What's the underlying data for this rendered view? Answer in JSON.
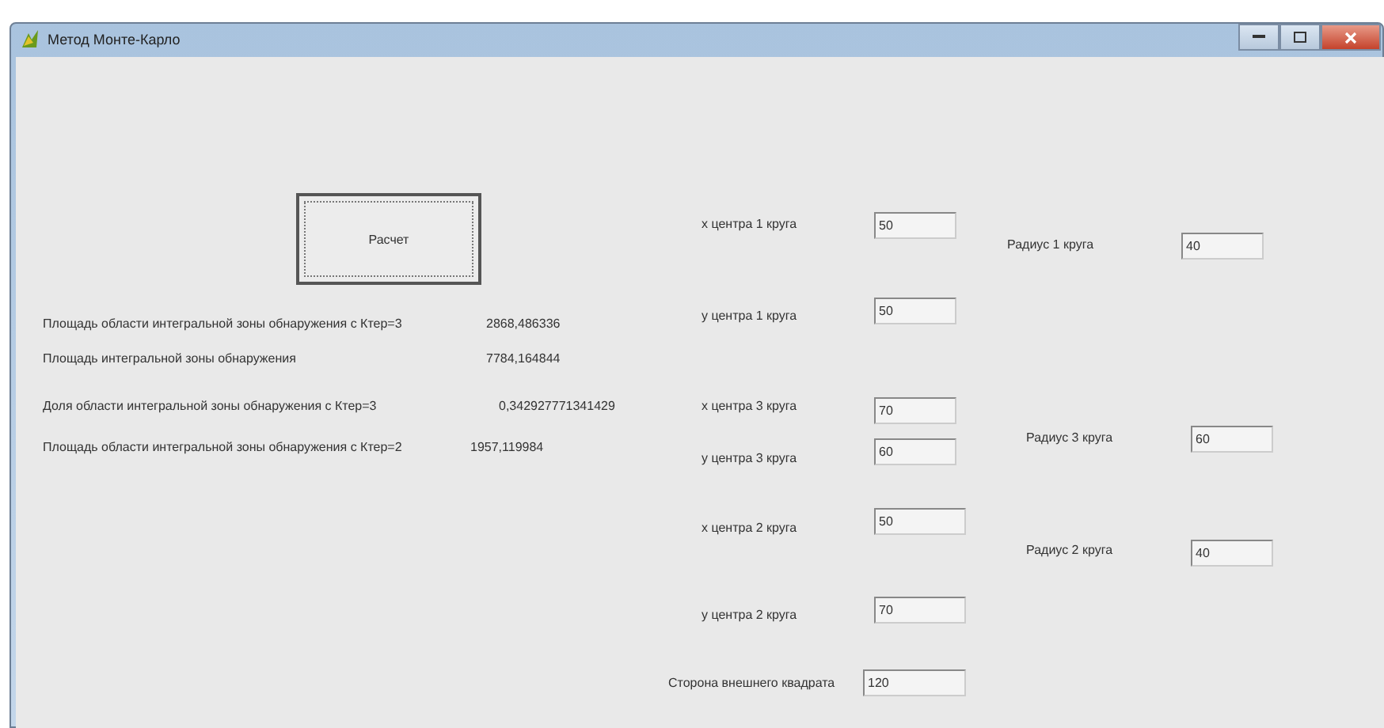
{
  "window": {
    "title": "Метод Монте-Карло"
  },
  "calc_button": {
    "label": "Расчет"
  },
  "results": [
    {
      "label": "Площадь области интегральной зоны обнаружения с Ктер=3",
      "value": "2868,486336"
    },
    {
      "label": "Площадь интегральной зоны обнаружения",
      "value": "7784,164844"
    },
    {
      "label": "Доля области интегральной зоны обнаружения с Ктер=3",
      "value": "0,342927771341429"
    },
    {
      "label": "Площадь области интегральной зоны обнаружения с  Ктер=2",
      "value": "1957,119984"
    }
  ],
  "inputs": [
    {
      "label": "x центра 1 круга",
      "value": "50"
    },
    {
      "label": "y центра 1 круга",
      "value": "50"
    },
    {
      "label": "x центра 3 круга",
      "value": "70"
    },
    {
      "label": "y центра 3 круга",
      "value": "60"
    },
    {
      "label": "x центра 2 круга",
      "value": "50"
    },
    {
      "label": "y центра 2 круга",
      "value": "70"
    },
    {
      "label": "Сторона внешнего квадрата",
      "value": "120"
    },
    {
      "label": "Радиус 1 круга",
      "value": "40"
    },
    {
      "label": "Радиус 3 круга",
      "value": "60"
    },
    {
      "label": "Радиус 2 круга",
      "value": "40"
    }
  ]
}
